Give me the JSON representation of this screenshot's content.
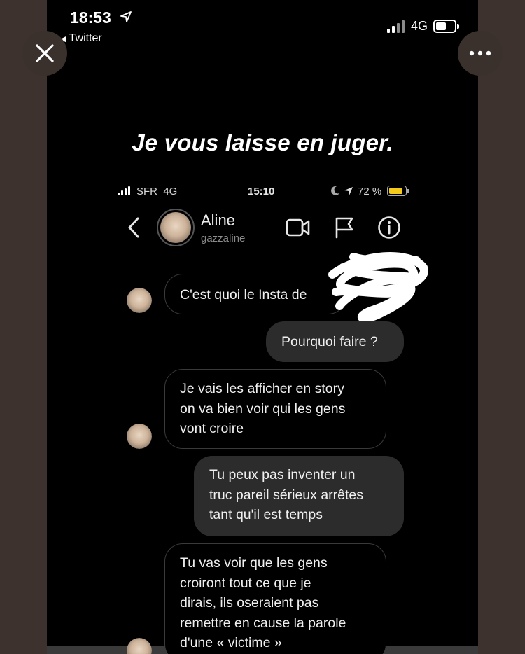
{
  "status_bar": {
    "time": "18:53",
    "back_app": "Twitter",
    "network": "4G"
  },
  "headline": "Je vous laisse en juger.",
  "inner_status": {
    "carrier": "SFR",
    "network": "4G",
    "time": "15:10",
    "battery": "72 %",
    "battery_color": "#f3c91b"
  },
  "dm_header": {
    "name": "Aline",
    "username": "gazzaline"
  },
  "messages": [
    {
      "side": "received",
      "text": "C'est quoi le Insta de"
    },
    {
      "side": "sent",
      "text": "Pourquoi faire ?"
    },
    {
      "side": "received",
      "lines": [
        "Je vais les afficher en story",
        "on va bien voir qui les gens",
        "vont croire"
      ]
    },
    {
      "side": "sent",
      "lines": [
        "Tu peux pas inventer un",
        "truc pareil sérieux arrêtes",
        "tant qu'il est temps"
      ]
    },
    {
      "side": "received",
      "lines": [
        "Tu vas voir que les gens",
        "croiront tout ce que je",
        "dirais, ils oseraient pas",
        "remettre en cause la parole",
        "d'une « victime »"
      ]
    }
  ],
  "icons": [
    "close-icon",
    "more-icon",
    "back-arrow-icon",
    "video-call-icon",
    "flag-icon",
    "info-icon",
    "location-arrow-icon",
    "moon-icon"
  ]
}
